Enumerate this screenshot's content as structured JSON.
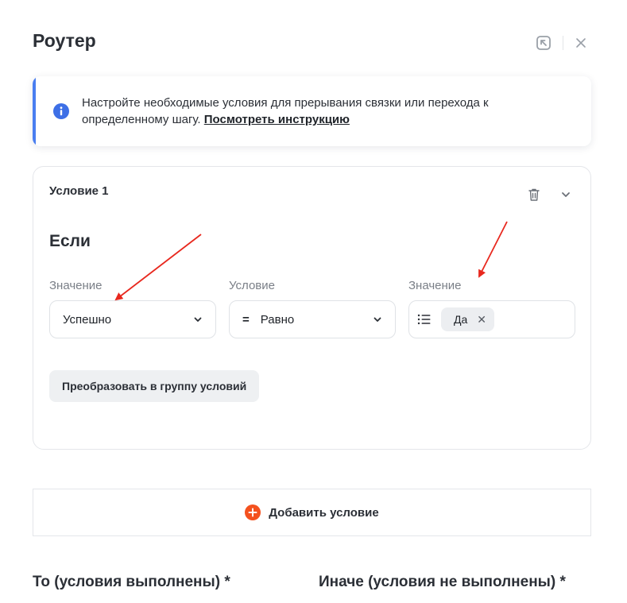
{
  "header": {
    "title": "Роутер"
  },
  "info": {
    "text": "Настройте необходимые условия для прерывания связки или перехода к определенному шагу. ",
    "link": "Посмотреть инструкцию",
    "accent_color": "#4a7ef0"
  },
  "condition": {
    "title": "Условие 1",
    "if_label": "Если",
    "fields": {
      "value_label": "Значение",
      "value_selected": "Успешно",
      "operator_label": "Условие",
      "operator_symbol": "=",
      "operator_selected": "Равно",
      "target_label": "Значение",
      "target_chip": "Да"
    },
    "convert_button": "Преобразовать в группу условий"
  },
  "add_condition": {
    "label": "Добавить условие",
    "icon_color": "#f4511e"
  },
  "outputs": {
    "then_label": "То (условия выполнены) *",
    "else_label": "Иначе (условия не выполнены) *"
  },
  "icons": {
    "header": [
      "expand-icon",
      "close-icon"
    ],
    "info": "info-icon",
    "card": [
      "trash-icon",
      "chevron-down-icon"
    ],
    "target": "list-icon",
    "add": "plus-circle-icon"
  },
  "annotation_color": "#e8281e"
}
